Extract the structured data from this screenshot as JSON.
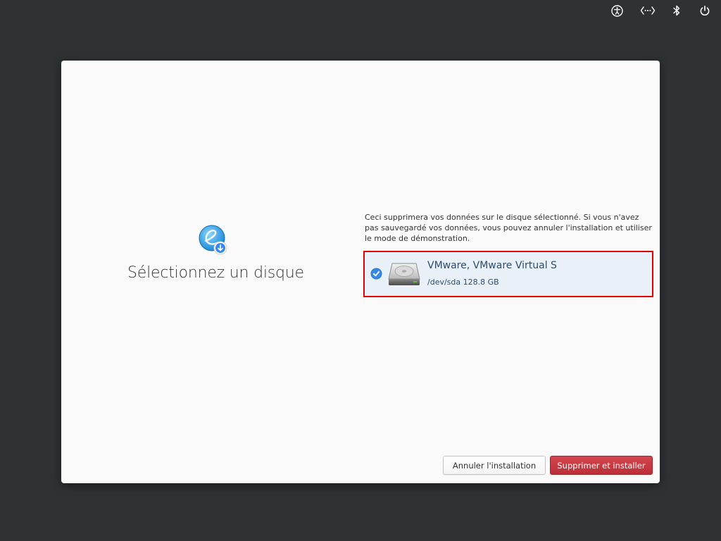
{
  "tray": {
    "icons": [
      "accessibility-icon",
      "network-icon",
      "bluetooth-icon",
      "power-icon"
    ]
  },
  "installer": {
    "title": "Sélectionnez un disque",
    "warning": "Ceci supprimera vos données sur le disque sélectionné. Si vous n'avez pas sauvegardé vos données, vous pouvez annuler l'installation et utiliser le mode de démonstration.",
    "disk": {
      "name": "VMware, VMware Virtual S",
      "details": "/dev/sda 128.8 GB",
      "selected": true
    },
    "buttons": {
      "cancel": "Annuler l'installation",
      "erase_install": "Supprimer et installer"
    }
  },
  "colors": {
    "desktop_bg": "#2e3234",
    "window_bg": "#fafafa",
    "accent_blue": "#3689e6",
    "destructive_red": "#c6262e",
    "selection_highlight": "#e10000"
  }
}
